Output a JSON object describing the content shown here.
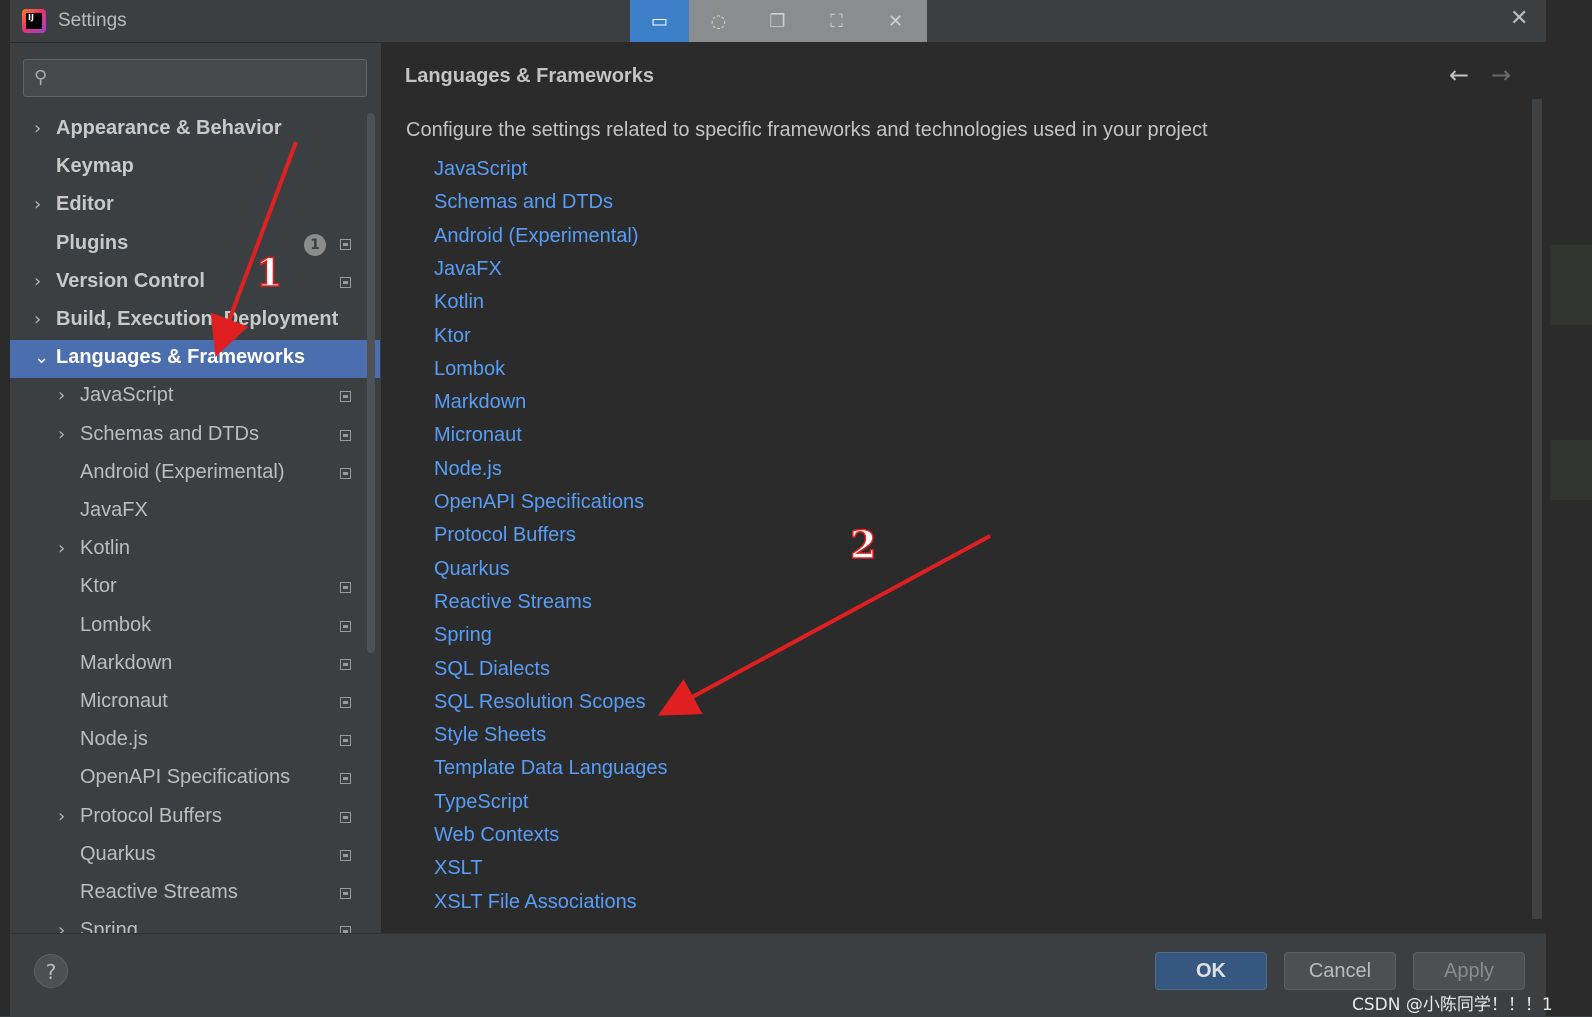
{
  "window": {
    "title": "Settings",
    "close_icon": "close-icon"
  },
  "snip_toolbar": [
    "rect-snip-icon",
    "freeform-snip-icon",
    "window-snip-icon",
    "fullscreen-snip-icon",
    "close-icon"
  ],
  "search": {
    "value": "",
    "placeholder": ""
  },
  "sidebar": {
    "items": [
      {
        "label": "Appearance & Behavior",
        "level": 0,
        "bold": true,
        "expandable": true
      },
      {
        "label": "Keymap",
        "level": 0,
        "bold": true,
        "expandable": false
      },
      {
        "label": "Editor",
        "level": 0,
        "bold": true,
        "expandable": true
      },
      {
        "label": "Plugins",
        "level": 0,
        "bold": true,
        "expandable": false,
        "badge": "1",
        "project_icon": true
      },
      {
        "label": "Version Control",
        "level": 0,
        "bold": true,
        "expandable": true,
        "project_icon": true
      },
      {
        "label": "Build, Execution, Deployment",
        "level": 0,
        "bold": true,
        "expandable": true
      },
      {
        "label": "Languages & Frameworks",
        "level": 0,
        "bold": true,
        "expandable": true,
        "expanded": true,
        "selected": true
      },
      {
        "label": "JavaScript",
        "level": 1,
        "expandable": true,
        "project_icon": true
      },
      {
        "label": "Schemas and DTDs",
        "level": 1,
        "expandable": true,
        "project_icon": true
      },
      {
        "label": "Android (Experimental)",
        "level": 1,
        "project_icon": true
      },
      {
        "label": "JavaFX",
        "level": 1
      },
      {
        "label": "Kotlin",
        "level": 1,
        "expandable": true
      },
      {
        "label": "Ktor",
        "level": 1,
        "project_icon": true
      },
      {
        "label": "Lombok",
        "level": 1,
        "project_icon": true
      },
      {
        "label": "Markdown",
        "level": 1,
        "project_icon": true
      },
      {
        "label": "Micronaut",
        "level": 1,
        "project_icon": true
      },
      {
        "label": "Node.js",
        "level": 1,
        "project_icon": true
      },
      {
        "label": "OpenAPI Specifications",
        "level": 1,
        "project_icon": true
      },
      {
        "label": "Protocol Buffers",
        "level": 1,
        "expandable": true,
        "project_icon": true
      },
      {
        "label": "Quarkus",
        "level": 1,
        "project_icon": true
      },
      {
        "label": "Reactive Streams",
        "level": 1,
        "project_icon": true
      },
      {
        "label": "Spring",
        "level": 1,
        "expandable": true,
        "project_icon": true
      }
    ]
  },
  "main": {
    "title": "Languages & Frameworks",
    "description": "Configure the settings related to specific frameworks and technologies used in your project",
    "links": [
      "JavaScript",
      "Schemas and DTDs",
      "Android (Experimental)",
      "JavaFX",
      "Kotlin",
      "Ktor",
      "Lombok",
      "Markdown",
      "Micronaut",
      "Node.js",
      "OpenAPI Specifications",
      "Protocol Buffers",
      "Quarkus",
      "Reactive Streams",
      "Spring",
      "SQL Dialects",
      "SQL Resolution Scopes",
      "Style Sheets",
      "Template Data Languages",
      "TypeScript",
      "Web Contexts",
      "XSLT",
      "XSLT File Associations"
    ]
  },
  "footer": {
    "help_label": "?",
    "ok_label": "OK",
    "cancel_label": "Cancel",
    "apply_label": "Apply"
  },
  "annotations": {
    "marker1": "1",
    "marker2": "2",
    "color": "#e02020"
  },
  "watermark": "CSDN @小陈同学！！！1"
}
